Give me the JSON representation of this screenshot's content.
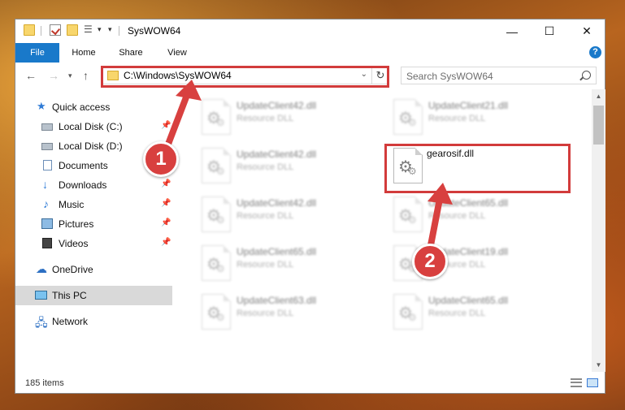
{
  "window": {
    "title": "SysWOW64",
    "controls": {
      "minimize": "—",
      "maximize": "☐",
      "close": "✕"
    }
  },
  "ribbon": {
    "tabs": [
      {
        "label": "File"
      },
      {
        "label": "Home"
      },
      {
        "label": "Share"
      },
      {
        "label": "View"
      }
    ],
    "help": "?"
  },
  "address_bar": {
    "path": "C:\\Windows\\SysWOW64",
    "search_placeholder": "Search SysWOW64"
  },
  "nav_pane": {
    "items": [
      {
        "label": "Quick access",
        "icon": "star-icon"
      },
      {
        "label": "Local Disk (C:)",
        "icon": "drive-icon",
        "pinned": true
      },
      {
        "label": "Local Disk (D:)",
        "icon": "drive-icon",
        "pinned": false
      },
      {
        "label": "Documents",
        "icon": "documents-icon",
        "pinned": true
      },
      {
        "label": "Downloads",
        "icon": "download-icon",
        "pinned": true
      },
      {
        "label": "Music",
        "icon": "music-icon",
        "pinned": true
      },
      {
        "label": "Pictures",
        "icon": "pictures-icon",
        "pinned": true
      },
      {
        "label": "Videos",
        "icon": "videos-icon",
        "pinned": true
      },
      {
        "label": "OneDrive",
        "icon": "cloud-icon"
      },
      {
        "label": "This PC",
        "icon": "computer-icon",
        "selected": true
      },
      {
        "label": "Network",
        "icon": "network-icon"
      }
    ]
  },
  "files": [
    {
      "name": "UpdateClient42.dll",
      "type": "Resource DLL",
      "blurred": true
    },
    {
      "name": "UpdateClient21.dll",
      "type": "Resource DLL",
      "blurred": true
    },
    {
      "name": "UpdateClient42.dll",
      "type": "Resource DLL",
      "blurred": true
    },
    {
      "name": "gearosif.dll",
      "type": "",
      "blurred": false,
      "highlighted": true
    },
    {
      "name": "UpdateClient42.dll",
      "type": "Resource DLL",
      "blurred": true
    },
    {
      "name": "UpdateClient65.dll",
      "type": "Resource DLL",
      "blurred": true
    },
    {
      "name": "UpdateClient65.dll",
      "type": "Resource DLL",
      "blurred": true
    },
    {
      "name": "UpdateClient19.dll",
      "type": "Resource DLL",
      "blurred": true
    },
    {
      "name": "UpdateClient63.dll",
      "type": "Resource DLL",
      "blurred": true
    },
    {
      "name": "UpdateClient65.dll",
      "type": "Resource DLL",
      "blurred": true
    }
  ],
  "status_bar": {
    "item_count": "185 items"
  },
  "callouts": {
    "step1": "1",
    "step2": "2"
  },
  "colors": {
    "accent": "#1979ca",
    "highlight": "#d23b3b",
    "badge": "#d8403f"
  }
}
